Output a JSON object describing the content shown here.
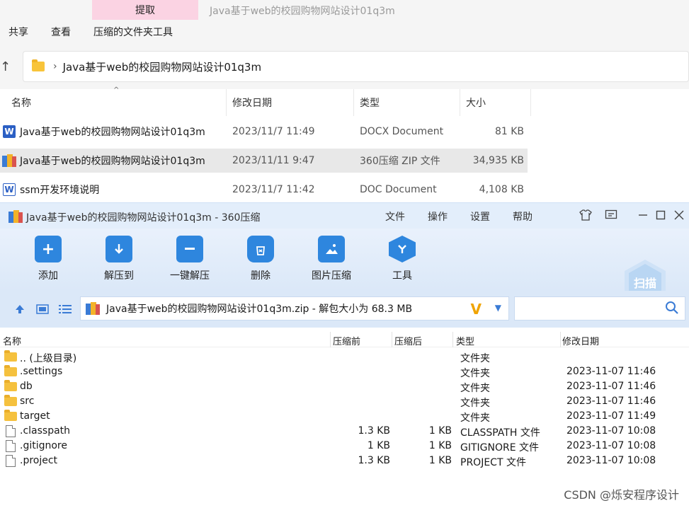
{
  "explorer": {
    "ribbon": {
      "extract_tab": "提取",
      "window_title": "Java基于web的校园购物网站设计01q3m"
    },
    "menu": [
      "共享",
      "查看",
      "压缩的文件夹工具"
    ],
    "breadcrumb": {
      "path": "Java基于web的校园购物网站设计01q3m"
    },
    "columns": {
      "name": "名称",
      "modified": "修改日期",
      "type": "类型",
      "size": "大小"
    },
    "files": [
      {
        "name": "Java基于web的校园购物网站设计01q3m",
        "modified": "2023/11/7 11:49",
        "type": "DOCX Document",
        "size": "81 KB",
        "icon": "word-icon"
      },
      {
        "name": "Java基于web的校园购物网站设计01q3m",
        "modified": "2023/11/11 9:47",
        "type": "360压缩 ZIP 文件",
        "size": "34,935 KB",
        "icon": "zip-icon"
      },
      {
        "name": "ssm开发环境说明",
        "modified": "2023/11/7 11:42",
        "type": "DOC Document",
        "size": "4,108 KB",
        "icon": "word-outline-icon"
      }
    ]
  },
  "zipwin": {
    "title": "Java基于web的校园购物网站设计01q3m - 360压缩",
    "menu": [
      "文件",
      "操作",
      "设置",
      "帮助"
    ],
    "toolbar": [
      {
        "label": "添加",
        "icon": "add-icon"
      },
      {
        "label": "解压到",
        "icon": "extract-to-icon"
      },
      {
        "label": "一键解压",
        "icon": "one-click-extract-icon"
      },
      {
        "label": "删除",
        "icon": "delete-icon"
      },
      {
        "label": "图片压缩",
        "icon": "image-compress-icon"
      },
      {
        "label": "工具",
        "icon": "tools-icon"
      }
    ],
    "scan_label": "扫描",
    "path_text": "Java基于web的校园购物网站设计01q3m.zip - 解包大小为 68.3 MB",
    "columns": {
      "name": "名称",
      "before": "压缩前",
      "after": "压缩后",
      "type": "类型",
      "modified": "修改日期"
    },
    "rows": [
      {
        "name": ".. (上级目录)",
        "before": "",
        "after": "",
        "type": "文件夹",
        "modified": "",
        "kind": "folder"
      },
      {
        "name": ".settings",
        "before": "",
        "after": "",
        "type": "文件夹",
        "modified": "2023-11-07 11:46",
        "kind": "folder"
      },
      {
        "name": "db",
        "before": "",
        "after": "",
        "type": "文件夹",
        "modified": "2023-11-07 11:46",
        "kind": "folder"
      },
      {
        "name": "src",
        "before": "",
        "after": "",
        "type": "文件夹",
        "modified": "2023-11-07 11:46",
        "kind": "folder"
      },
      {
        "name": "target",
        "before": "",
        "after": "",
        "type": "文件夹",
        "modified": "2023-11-07 11:49",
        "kind": "folder"
      },
      {
        "name": ".classpath",
        "before": "1.3 KB",
        "after": "1 KB",
        "type": "CLASSPATH 文件",
        "modified": "2023-11-07 10:08",
        "kind": "file"
      },
      {
        "name": ".gitignore",
        "before": "1 KB",
        "after": "1 KB",
        "type": "GITIGNORE 文件",
        "modified": "2023-11-07 10:08",
        "kind": "file"
      },
      {
        "name": ".project",
        "before": "1.3 KB",
        "after": "1 KB",
        "type": "PROJECT 文件",
        "modified": "2023-11-07 10:08",
        "kind": "file"
      }
    ]
  },
  "watermark": "CSDN @烁安程序设计",
  "colors": {
    "accent": "#2e86de",
    "extract_tab": "#fbd3e3",
    "toolbar_bg": "#dbe8f8"
  }
}
